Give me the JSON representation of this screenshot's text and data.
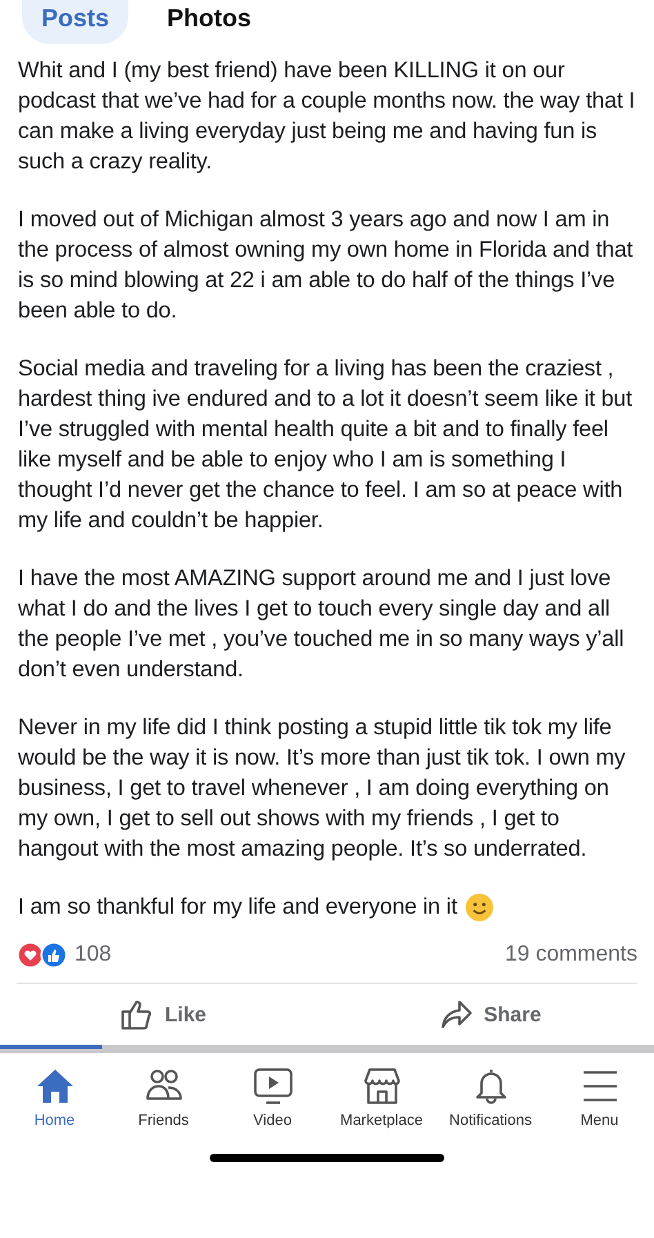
{
  "tabs": [
    {
      "label": "Posts",
      "selected": true
    },
    {
      "label": "Photos",
      "selected": false
    }
  ],
  "post": {
    "paragraphs": [
      "Whit and I (my best friend) have been KILLING it on our podcast that we’ve had for a couple months now. the way that I can make a living everyday just being me and having fun is such a crazy reality.",
      "I moved out of Michigan almost 3 years ago and now I am in the process of almost owning my own home in Florida and that is so mind blowing at 22 i am able to do half of the things I’ve been able to do.",
      "Social media and traveling for a living has been the craziest , hardest thing ive endured and to a lot it doesn’t seem like it but I’ve  struggled with mental health quite a bit and to finally feel like myself and be able to enjoy who I am is something I thought I’d never get the chance to feel. I am so at peace with my life and couldn’t be happier.",
      "I have the most AMAZING support around me and I just love what I do and the lives I get to touch every single day and all the people I’ve met , you’ve touched me in so many ways y’all don’t even understand.",
      "Never in my life did I think posting a stupid little tik tok my life would be the way it is now. It’s more than just tik tok. I own my business, I get to travel whenever , I am doing everything on my own, I get to sell out shows with my friends , I get to hangout with the most amazing people. It’s so underrated.",
      "I am so thankful for my life and everyone in it"
    ],
    "reaction_count": "108",
    "comments": "19 comments",
    "actions": [
      {
        "kind": "like",
        "label": "Like"
      },
      {
        "kind": "share",
        "label": "Share"
      }
    ]
  },
  "nav": [
    {
      "kind": "home",
      "label": "Home",
      "selected": true
    },
    {
      "kind": "friends",
      "label": "Friends",
      "selected": false
    },
    {
      "kind": "video",
      "label": "Video",
      "selected": false
    },
    {
      "kind": "marketplace",
      "label": "Marketplace",
      "selected": false
    },
    {
      "kind": "notifications",
      "label": "Notifications",
      "selected": false
    },
    {
      "kind": "menu",
      "label": "Menu",
      "selected": false
    }
  ]
}
